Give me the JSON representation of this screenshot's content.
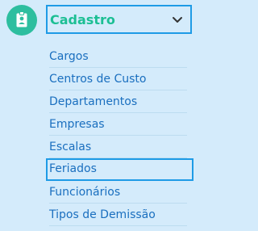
{
  "menu": {
    "section_icon": "id-badge-icon",
    "title": "Cadastro",
    "toggle_icon": "chevron-down-icon",
    "expanded": true,
    "items": [
      {
        "label": "Cargos"
      },
      {
        "label": "Centros de Custo"
      },
      {
        "label": "Departamentos"
      },
      {
        "label": "Empresas"
      },
      {
        "label": "Escalas"
      },
      {
        "label": "Feriados",
        "highlighted": true
      },
      {
        "label": "Funcionários"
      },
      {
        "label": "Tipos de Demissão"
      }
    ]
  },
  "colors": {
    "background": "#d4ebfb",
    "accent_green": "#1cbf94",
    "link_blue": "#1a6fbf",
    "focus_border": "#1e9be6"
  }
}
